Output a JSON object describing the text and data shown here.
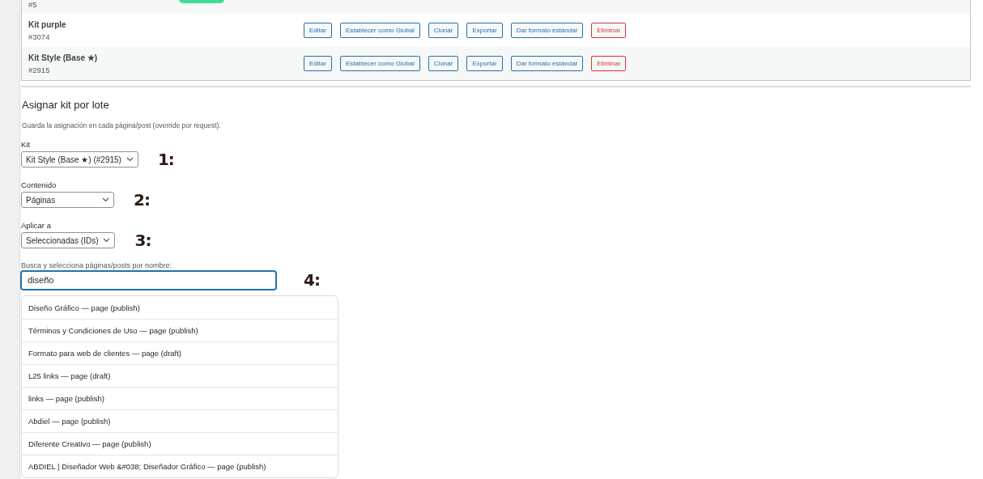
{
  "kits": [
    {
      "id": "#5",
      "badge": true
    },
    {
      "name": "Kit purple",
      "id": "#3074",
      "badge": false,
      "buttons": [
        {
          "label": "Editar",
          "kind": "default"
        },
        {
          "label": "Establecer como Global",
          "kind": "default"
        },
        {
          "label": "Clonar",
          "kind": "default"
        },
        {
          "label": "Exportar",
          "kind": "default"
        },
        {
          "label": "Dar formato estándar",
          "kind": "default"
        },
        {
          "label": "Eliminar",
          "kind": "danger"
        }
      ]
    },
    {
      "name": "Kit Style (Base ★)",
      "id": "#2915",
      "badge": false,
      "buttons": [
        {
          "label": "Editar",
          "kind": "default"
        },
        {
          "label": "Establecer como Global",
          "kind": "default"
        },
        {
          "label": "Clonar",
          "kind": "default"
        },
        {
          "label": "Exportar",
          "kind": "default"
        },
        {
          "label": "Dar formato estándar",
          "kind": "default"
        },
        {
          "label": "Eliminar",
          "kind": "danger"
        }
      ]
    }
  ],
  "bulk": {
    "title": "Asignar kit por lote",
    "description": "Guarda la asignación en cada página/post (override por request).",
    "selects": [
      {
        "label": "Kit",
        "value": "Kit Style (Base ★) (#2915)",
        "marker": "1:"
      },
      {
        "label": "Contenido",
        "value": "Páginas",
        "marker": "2:"
      },
      {
        "label": "Aplicar a",
        "value": "Seleccionadas (IDs)",
        "marker": "3:"
      }
    ],
    "search": {
      "label": "Busca y selecciona páginas/posts por nombre:",
      "value": "diseño",
      "marker": "4:"
    },
    "results": [
      "Diseño Gráfico — page (publish)",
      "Términos y Condiciones de Uso — page (publish)",
      "Formato para web de clientes — page (draft)",
      "L25 links — page (draft)",
      "links — page (publish)",
      "Abdiel — page (publish)",
      "Diferente Creativo — page (publish)",
      "ABDIEL | Diseñador Web &#038; Diseñador Gráfico — page (publish)"
    ]
  }
}
